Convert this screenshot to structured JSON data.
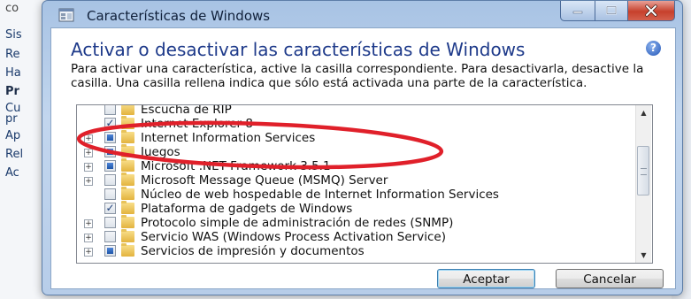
{
  "background_app": {
    "top_text": "co",
    "items": [
      "Sis",
      "Re",
      "Ha",
      "Pr",
      "Cu",
      "pr",
      "Ap",
      "Rel",
      "Ac"
    ]
  },
  "window": {
    "title": "Características de Windows",
    "heading": "Activar o desactivar las características de Windows",
    "description": "Para activar una característica, active la casilla correspondiente. Para desactivarla, desactive la casilla. Una casilla rellena indica que sólo está activada una parte de la característica.",
    "help_glyph": "?"
  },
  "features": [
    {
      "label": "Escucha de RIP",
      "state": "unchecked",
      "expandable": false
    },
    {
      "label": "Internet Explorer 8",
      "state": "checked",
      "expandable": false
    },
    {
      "label": "Internet Information Services",
      "state": "partial",
      "expandable": true
    },
    {
      "label": "Juegos",
      "state": "partial",
      "expandable": true
    },
    {
      "label": "Microsoft .NET Framework 3.5.1",
      "state": "partial",
      "expandable": true
    },
    {
      "label": "Microsoft Message Queue (MSMQ) Server",
      "state": "unchecked",
      "expandable": true
    },
    {
      "label": "Núcleo de web hospedable de Internet Information Services",
      "state": "unchecked",
      "expandable": false
    },
    {
      "label": "Plataforma de gadgets de Windows",
      "state": "checked",
      "expandable": false
    },
    {
      "label": "Protocolo simple de administración de redes (SNMP)",
      "state": "unchecked",
      "expandable": true
    },
    {
      "label": "Servicio WAS (Windows Process Activation Service)",
      "state": "unchecked",
      "expandable": true
    },
    {
      "label": "Servicios de impresión y documentos",
      "state": "partial",
      "expandable": true
    }
  ],
  "buttons": {
    "ok": "Aceptar",
    "cancel": "Cancelar"
  },
  "colors": {
    "heading": "#1e3a8a",
    "annotation": "#e0202a"
  }
}
